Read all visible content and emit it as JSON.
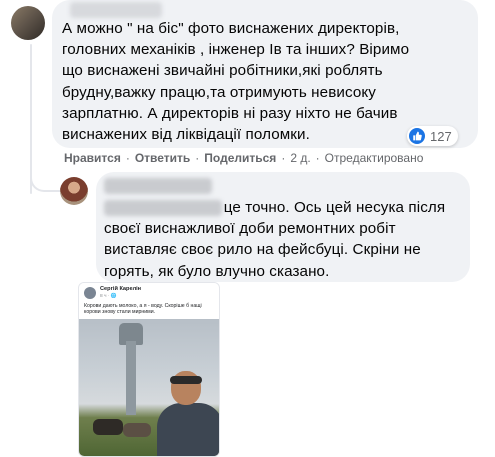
{
  "comment": {
    "text_lines": [
      "А можно \" на біс\" фото виснажених директорів,",
      "головних механіків , інженер Ів та інших? Віримо",
      "що виснажені звичайні робітники,які роблять",
      "брудну,важку працю,та отримують невисоку",
      "зарплатню. А директорів ні разу ніхто не бачив",
      "виснажених від ліквідації поломки."
    ],
    "reaction_icon": "like-icon",
    "reaction_count": "127",
    "actions": {
      "like": "Нравится",
      "reply": "Ответить",
      "share": "Поделиться",
      "time": "2 д.",
      "edited": "Отредактировано"
    }
  },
  "reply": {
    "text_lines": [
      "це точно. Ось цей несука після",
      "своєї виснажливої доби ремонтних робіт",
      "виставляє своє рило на фейсбуці. Скріни не",
      "горять, як було влучно сказано."
    ],
    "attachment": {
      "author": "Сергій Карелін",
      "meta": "8 ч · 🌐",
      "text": "Корови дають молоко, а я - воду. Скоріше б нащі корови знову стали мирними."
    }
  },
  "colors": {
    "bubble": "#f0f2f5",
    "secondary_text": "#65676b",
    "like_blue": "#1b74e4"
  }
}
